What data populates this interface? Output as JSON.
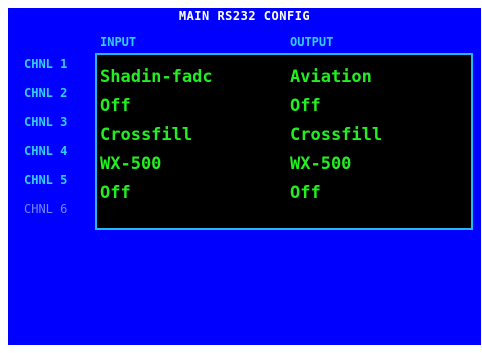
{
  "title": "MAIN RS232 CONFIG",
  "columns": {
    "input": "INPUT",
    "output": "OUTPUT"
  },
  "channels": [
    {
      "label": "CHNL 1",
      "input": "Shadin-fadc",
      "output": "Aviation",
      "enabled": true
    },
    {
      "label": "CHNL 2",
      "input": "Off",
      "output": "Off",
      "enabled": true
    },
    {
      "label": "CHNL 3",
      "input": "Crossfill",
      "output": "Crossfill",
      "enabled": true
    },
    {
      "label": "CHNL 4",
      "input": "WX-500",
      "output": "WX-500",
      "enabled": true
    },
    {
      "label": "CHNL 5",
      "input": "Off",
      "output": "Off",
      "enabled": true
    },
    {
      "label": "CHNL 6",
      "input": "",
      "output": "",
      "enabled": false
    }
  ],
  "colors": {
    "background": "#0000ff",
    "header_text": "#ffffff",
    "label_text": "#33ccff",
    "disabled_label_text": "#6f86ff",
    "value_text": "#22ee22",
    "panel_background": "#000000",
    "panel_border": "#20b8ff"
  }
}
